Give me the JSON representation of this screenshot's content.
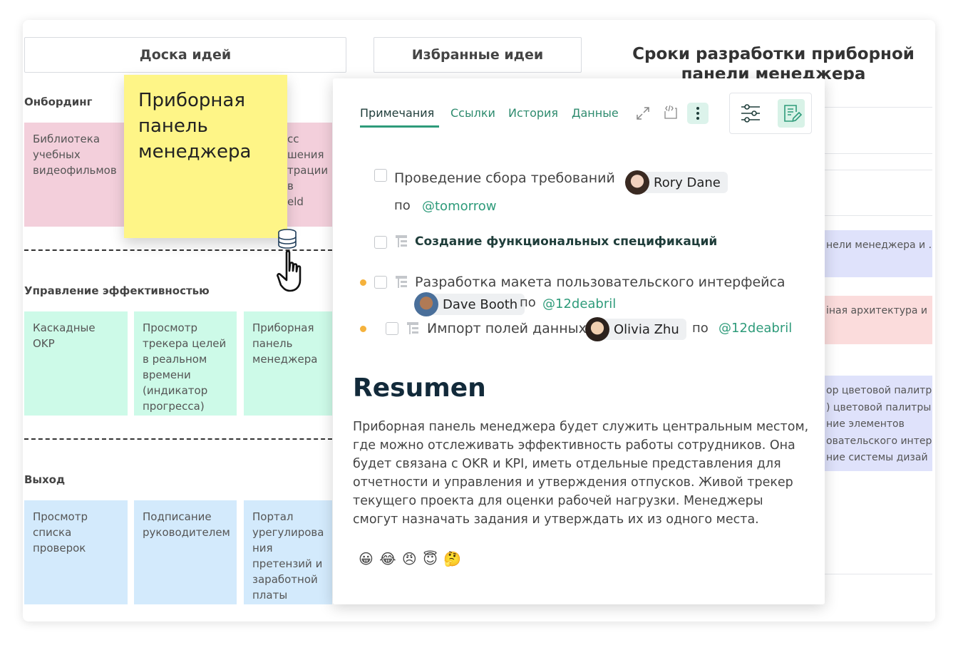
{
  "board": {
    "tabs": [
      "Доска идей",
      "Избранные идеи"
    ],
    "title": "Сроки разработки приборной панели менеджера",
    "sections": [
      {
        "label": "Онбординг",
        "cards": [
          "Библиотека учебных видеофильмов",
          "сс\nшения\nтрации в\neld"
        ]
      },
      {
        "label": "Управление эффективностью",
        "cards": [
          "Каскадные OKР",
          "Просмотр трекера целей в реальном времени (индикатор прогресса)",
          "Приборная панель менеджера"
        ]
      },
      {
        "label": "Выход",
        "cards": [
          "Просмотр списка проверок",
          "Подписание руководителем",
          "Портал урегулирова ния претензий и заработной платы"
        ]
      }
    ],
    "sticky": "Приборная\nпанель\nменеджера",
    "right_items": [
      "нели менеджера и ...",
      "іная архитектура и",
      "ор цветовой палитр\n) цветовой палитры\nние элементов\nовательского интер\nние системы дизай"
    ]
  },
  "panel": {
    "tabs": [
      "Примечания",
      "Ссылки",
      "История",
      "Данные"
    ],
    "active_tab": 0,
    "accent": "#2e8b6e",
    "tasks": [
      {
        "text": "Проведение сбора требований",
        "assignee": "Rory Dane",
        "by": "по",
        "due": "@tomorrow"
      },
      {
        "text": "Создание функциональных спецификаций"
      },
      {
        "text": "Разработка макета пользовательского интерфейса",
        "assignee": "Dave Booth",
        "by": "по",
        "due": "@12deabril"
      },
      {
        "text": "Импорт полей данных",
        "assignee": "Olivia Zhu",
        "by": "по",
        "due": "@12deabril"
      }
    ],
    "summary_title": "Resumen",
    "summary": "Приборная панель менеджера будет служить центральным местом, где можно отслеживать эффективность работы сотрудников. Она будет связана с OKR и KPI, иметь отдельные представления для отчетности и управления и утверждения отпусков.  Живой трекер текущего проекта для оценки рабочей нагрузки. Менеджеры смогут назначать задания и утверждать их из одного места.",
    "emojis": "😀 😂 😠 😇 🤔"
  }
}
